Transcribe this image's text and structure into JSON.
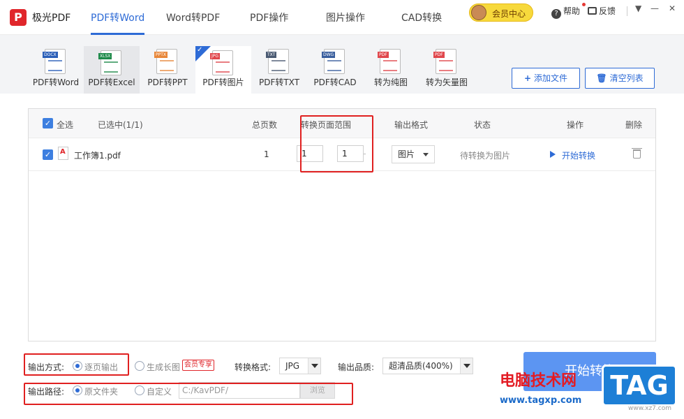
{
  "app": {
    "logo_letter": "P",
    "name": "极光PDF"
  },
  "nav": {
    "tabs": [
      {
        "label": "PDF转Word",
        "active": true
      },
      {
        "label": "Word转PDF",
        "active": false
      },
      {
        "label": "PDF操作",
        "active": false
      },
      {
        "label": "图片操作",
        "active": false
      },
      {
        "label": "CAD转换",
        "active": false
      }
    ]
  },
  "header": {
    "vip_label": "会员中心",
    "help_label": "帮助",
    "feedback_label": "反馈",
    "menu_icon": "▼",
    "minimize_icon": "—",
    "close_icon": "✕"
  },
  "toolbar": {
    "tools": [
      {
        "label": "PDF转Word",
        "tag": "DOCX",
        "tag_color": "#2b5fb8",
        "state": "normal"
      },
      {
        "label": "PDF转Excel",
        "tag": "XLSX",
        "tag_color": "#1e8a4a",
        "state": "hover"
      },
      {
        "label": "PDF转PPT",
        "tag": "PPTX",
        "tag_color": "#e8873a",
        "state": "normal"
      },
      {
        "label": "PDF转图片",
        "tag": "JPG",
        "tag_color": "#e0474c",
        "state": "active"
      },
      {
        "label": "PDF转TXT",
        "tag": "TXT",
        "tag_color": "#4a5a72",
        "state": "normal"
      },
      {
        "label": "PDF转CAD",
        "tag": "DWG",
        "tag_color": "#3a5f9e",
        "state": "normal"
      },
      {
        "label": "转为纯图",
        "tag": "PDF",
        "tag_color": "#e0474c",
        "state": "normal"
      },
      {
        "label": "转为矢量图",
        "tag": "PDF",
        "tag_color": "#e0474c",
        "state": "normal"
      }
    ],
    "add_file_label": "添加文件",
    "clear_list_label": "清空列表"
  },
  "table": {
    "headers": {
      "select_all": "全选",
      "selected": "已选中(1/1)",
      "total_pages": "总页数",
      "page_range": "转换页面范围",
      "output_format": "输出格式",
      "status": "状态",
      "action": "操作",
      "delete": "删除"
    },
    "rows": [
      {
        "file_name": "工作簿1.pdf",
        "total_pages": "1",
        "range_from": "1",
        "range_to": "1",
        "format": "图片",
        "status": "待转换为图片",
        "action": "开始转换"
      }
    ]
  },
  "options": {
    "output_mode_label": "输出方式:",
    "mode_per_page": "逐页输出",
    "mode_long_image": "生成长图",
    "vip_badge": "会员专享",
    "convert_format_label": "转换格式:",
    "convert_format_value": "JPG",
    "quality_label": "输出品质:",
    "quality_value": "超清品质(400%)",
    "output_path_label": "输出路径:",
    "path_original": "原文件夹",
    "path_custom": "自定义",
    "path_value": "C:/KavPDF/",
    "browse_label": "浏览",
    "start_button": "开始转换"
  },
  "watermark": {
    "site_cn": "电脑技术网",
    "site_url": "www.tagxp.com",
    "tag": "TAG",
    "small": "www.xz7.com"
  },
  "colors": {
    "accent": "#2e6bd6",
    "brand_red": "#e0262b",
    "highlight_box": "#e02020",
    "start_button": "#5c95f2"
  }
}
